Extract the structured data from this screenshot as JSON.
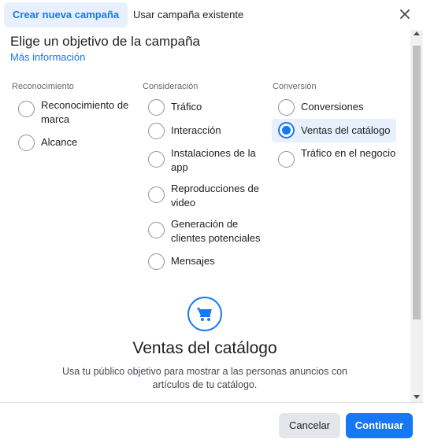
{
  "tabs": [
    {
      "label": "Crear nueva campaña",
      "active": true
    },
    {
      "label": "Usar campaña existente",
      "active": false
    }
  ],
  "heading": "Elige un objetivo de la campaña",
  "more_info": "Más información",
  "columns": [
    {
      "title": "Reconocimiento",
      "options": [
        {
          "label": "Reconocimiento de marca",
          "selected": false
        },
        {
          "label": "Alcance",
          "selected": false
        }
      ]
    },
    {
      "title": "Consideración",
      "options": [
        {
          "label": "Tráfico",
          "selected": false
        },
        {
          "label": "Interacción",
          "selected": false
        },
        {
          "label": "Instalaciones de la app",
          "selected": false
        },
        {
          "label": "Reproducciones de video",
          "selected": false
        },
        {
          "label": "Generación de clientes potenciales",
          "selected": false
        },
        {
          "label": "Mensajes",
          "selected": false
        }
      ]
    },
    {
      "title": "Conversión",
      "options": [
        {
          "label": "Conversiones",
          "selected": false
        },
        {
          "label": "Ventas del catálogo",
          "selected": true
        },
        {
          "label": "Tráfico en el negocio",
          "selected": false
        }
      ]
    }
  ],
  "detail": {
    "icon": "cart-icon",
    "title": "Ventas del catálogo",
    "description": "Usa tu público objetivo para mostrar a las personas anuncios con artículos de tu catálogo."
  },
  "footer": {
    "cancel_label": "Cancelar",
    "continue_label": "Continuar"
  },
  "colors": {
    "accent": "#1877f2",
    "accent_light": "#e7f0fc"
  }
}
